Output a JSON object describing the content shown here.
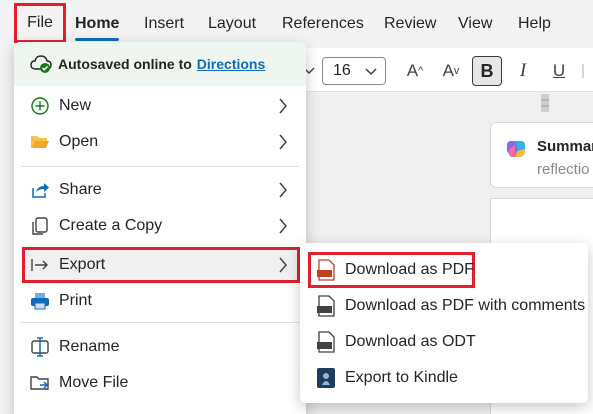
{
  "ribbon": {
    "tabs": [
      "File",
      "Home",
      "Insert",
      "Layout",
      "References",
      "Review",
      "View",
      "Help"
    ]
  },
  "toolbar": {
    "font_size": "16",
    "grow_label": "A",
    "shrink_label": "A",
    "bold_label": "B",
    "italic_label": "I",
    "underline_label": "U"
  },
  "file_menu": {
    "autosave_text": "Autosaved online to",
    "autosave_link": "Directions",
    "items": [
      {
        "label": "New",
        "icon": "plus-circle-icon"
      },
      {
        "label": "Open",
        "icon": "folder-open-icon"
      },
      {
        "label": "Share",
        "icon": "share-icon"
      },
      {
        "label": "Create a Copy",
        "icon": "copy-icon"
      },
      {
        "label": "Export",
        "icon": "export-arrow-icon"
      },
      {
        "label": "Print",
        "icon": "printer-icon"
      },
      {
        "label": "Rename",
        "icon": "rename-icon"
      },
      {
        "label": "Move File",
        "icon": "move-folder-icon"
      }
    ]
  },
  "export_submenu": {
    "items": [
      {
        "label": "Download as PDF",
        "icon": "pdf-file-icon"
      },
      {
        "label": "Download as PDF with comments",
        "icon": "pdf-comments-icon"
      },
      {
        "label": "Download as ODT",
        "icon": "odt-file-icon"
      },
      {
        "label": "Export to Kindle",
        "icon": "kindle-icon"
      }
    ]
  },
  "document": {
    "copilot_title": "Summar",
    "copilot_subtitle": "reflectio"
  },
  "colors": {
    "highlight_red": "#e0202e",
    "accent_blue": "#0f6cbd",
    "autosave_bg": "#eff6ef"
  }
}
